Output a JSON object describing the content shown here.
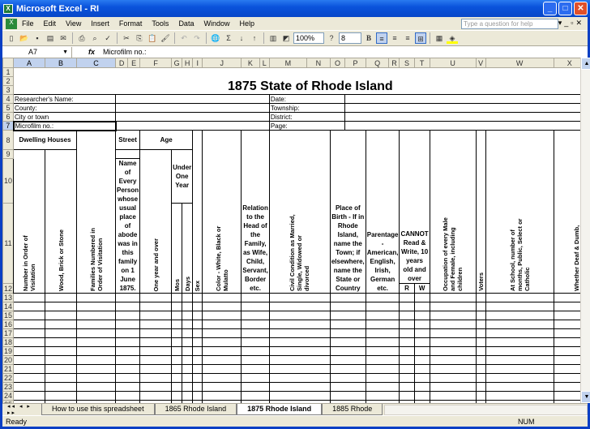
{
  "window": {
    "title": "Microsoft Excel - RI",
    "icon": "excel-icon"
  },
  "menu": [
    "File",
    "Edit",
    "View",
    "Insert",
    "Format",
    "Tools",
    "Data",
    "Window",
    "Help"
  ],
  "help_placeholder": "Type a question for help",
  "toolbar": {
    "zoom": "100%",
    "font_size": "8",
    "bold": "B"
  },
  "formula": {
    "cell": "A7",
    "fx": "fx",
    "value": "Microfilm no.:"
  },
  "columns": [
    "A",
    "B",
    "C",
    "D",
    "E",
    "F",
    "G",
    "H",
    "I",
    "J",
    "K",
    "L",
    "M",
    "N",
    "O",
    "P",
    "Q",
    "R",
    "S",
    "T",
    "U",
    "V",
    "W",
    "X",
    "Y",
    "Z"
  ],
  "sheet": {
    "title": "1875 State of Rhode Island",
    "info_left": [
      "Researcher's Name:",
      "County:",
      "City or town",
      "Microfilm no.:"
    ],
    "info_right": [
      "Date:",
      "Township:",
      "District:",
      "Page:"
    ],
    "headers": {
      "dwelling": "Dwelling Houses",
      "number_order": "Number in Order of Visitation",
      "wood_brick": "Wood, Brick or Stone",
      "families": "Families Numbered in Order of Visitation",
      "street": "Street",
      "name": "Name of Every Person whose usual place of abode was in this family on 1 June 1875.",
      "age": "Age",
      "one_year": "One year and over",
      "under_one": "Under One Year",
      "mos": "Mos",
      "days": "Days",
      "sex": "Sex",
      "color": "Color - White, Black or Mulatto",
      "relation": "Relation to the Head of the Family, as Wife, Child, Servant, Border etc.",
      "civil": "Civil Condition as Married, Single, Widowed or divorced",
      "birth": "Place of Birth - If in Rhode Island, name the Town; if elsewhere, name the State or Country",
      "parentage": "Parentage - American, English, Irish, German etc.",
      "cannot": "CANNOT Read & Write, 10 years old and over",
      "r": "R",
      "w": "W",
      "occupation": "Occupation of every Male and Female, including children",
      "voters": "Voters",
      "school": "At School, number of months, Public, Select or Catholic",
      "deaf": "Whether Deaf & Dumb, Blind, Insane or Idiotic"
    }
  },
  "rows": [
    "1",
    "2",
    "3",
    "4",
    "5",
    "6",
    "7",
    "8",
    "9",
    "10",
    "11",
    "12",
    "13",
    "14",
    "15",
    "16",
    "17",
    "18",
    "19",
    "20",
    "21",
    "22",
    "23",
    "24",
    "25",
    "26",
    "27",
    "28",
    "29",
    "30",
    "31",
    "32",
    "33"
  ],
  "tabs": [
    "How to use this spreadsheet",
    "1865 Rhode Island",
    "1875 Rhode Island",
    "1885 Rhode"
  ],
  "active_tab": "1875 Rhode Island",
  "status": {
    "left": "Ready",
    "right": "NUM"
  }
}
